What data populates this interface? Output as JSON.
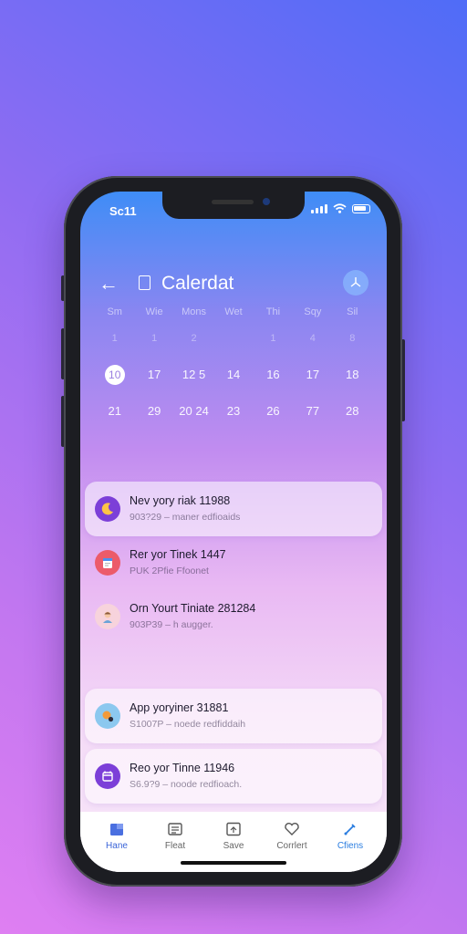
{
  "status": {
    "time": "Sc11"
  },
  "header": {
    "title": "Calerdat"
  },
  "calendar": {
    "weekdays": [
      "Sm",
      "Wie",
      "Mons",
      "Wet",
      "Thi",
      "Sqy",
      "Sil"
    ],
    "rows": [
      [
        "1",
        "1",
        "2",
        "",
        "1",
        "4",
        "8"
      ],
      [
        "10",
        "17",
        "12 5",
        "14",
        "16",
        "17",
        "18"
      ],
      [
        "21",
        "29",
        "20 24",
        "23",
        "26",
        "77",
        "28"
      ]
    ],
    "selected": "10"
  },
  "events": [
    {
      "title": "Nev yory riak 11988",
      "subtitle": "903?29 – maner edfioaids",
      "icon": "moon-icon",
      "color": "#7c3fd8"
    },
    {
      "title": "Rer yor Tinek 1447",
      "subtitle": "PUK 2Pfie Ffoonet",
      "icon": "calendar-page-icon",
      "color": "#ec5b6a"
    },
    {
      "title": "Orn Yourt Tiniate 281284",
      "subtitle": "903P39 – h augger.",
      "icon": "person-icon",
      "color": "#f1c4cf"
    },
    {
      "title": "App yoryiner 31881",
      "subtitle": "S1007P – noede redfiddaih",
      "icon": "basketball-icon",
      "color": "#8cc8ef"
    },
    {
      "title": "Reo yor Tinne 11946",
      "subtitle": "S6.9?9 – noode redfioach.",
      "icon": "calendar-icon",
      "color": "#7c3fd8"
    }
  ],
  "tabs": [
    {
      "label": "Hane",
      "icon": "home-icon"
    },
    {
      "label": "Fleat",
      "icon": "feed-icon"
    },
    {
      "label": "Save",
      "icon": "save-icon"
    },
    {
      "label": "Corrlert",
      "icon": "heart-icon"
    },
    {
      "label": "Cfiens",
      "icon": "pen-icon"
    }
  ]
}
